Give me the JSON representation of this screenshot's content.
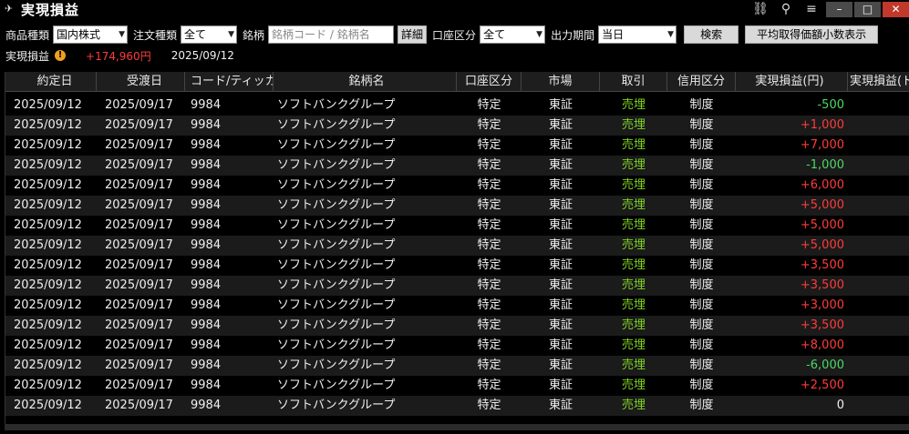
{
  "window": {
    "title": "実現損益",
    "icons": [
      "link-icon",
      "search-icon",
      "menu-icon"
    ],
    "minimize": "–",
    "maximize": "□",
    "close": "✕"
  },
  "filters": {
    "product_label": "商品種類",
    "product_value": "国内株式",
    "order_label": "注文種類",
    "order_value": "全て",
    "symbol_label": "銘柄",
    "symbol_placeholder": "銘柄コード / 銘柄名",
    "detail_button": "詳細",
    "account_label": "口座区分",
    "account_value": "全て",
    "period_label": "出力期間",
    "period_value": "当日",
    "search_button": "検索",
    "avg_button": "平均取得価額小数表示"
  },
  "summary": {
    "label": "実現損益",
    "value": "+174,960円",
    "date": "2025/09/12"
  },
  "table": {
    "headers": [
      "約定日",
      "受渡日",
      "コード/ティッカー",
      "銘柄名",
      "口座区分",
      "市場",
      "取引",
      "信用区分",
      "実現損益(円)",
      "実現損益(ド"
    ],
    "rows": [
      {
        "trade_date": "2025/09/12",
        "settle_date": "2025/09/17",
        "code": "9984",
        "name": "ソフトバンクグループ",
        "account": "特定",
        "market": "東証",
        "trade": "売埋",
        "margin": "制度",
        "pnl": "-500",
        "sign": "neg"
      },
      {
        "trade_date": "2025/09/12",
        "settle_date": "2025/09/17",
        "code": "9984",
        "name": "ソフトバンクグループ",
        "account": "特定",
        "market": "東証",
        "trade": "売埋",
        "margin": "制度",
        "pnl": "+1,000",
        "sign": "pos"
      },
      {
        "trade_date": "2025/09/12",
        "settle_date": "2025/09/17",
        "code": "9984",
        "name": "ソフトバンクグループ",
        "account": "特定",
        "market": "東証",
        "trade": "売埋",
        "margin": "制度",
        "pnl": "+7,000",
        "sign": "pos"
      },
      {
        "trade_date": "2025/09/12",
        "settle_date": "2025/09/17",
        "code": "9984",
        "name": "ソフトバンクグループ",
        "account": "特定",
        "market": "東証",
        "trade": "売埋",
        "margin": "制度",
        "pnl": "-1,000",
        "sign": "neg"
      },
      {
        "trade_date": "2025/09/12",
        "settle_date": "2025/09/17",
        "code": "9984",
        "name": "ソフトバンクグループ",
        "account": "特定",
        "market": "東証",
        "trade": "売埋",
        "margin": "制度",
        "pnl": "+6,000",
        "sign": "pos"
      },
      {
        "trade_date": "2025/09/12",
        "settle_date": "2025/09/17",
        "code": "9984",
        "name": "ソフトバンクグループ",
        "account": "特定",
        "market": "東証",
        "trade": "売埋",
        "margin": "制度",
        "pnl": "+5,000",
        "sign": "pos"
      },
      {
        "trade_date": "2025/09/12",
        "settle_date": "2025/09/17",
        "code": "9984",
        "name": "ソフトバンクグループ",
        "account": "特定",
        "market": "東証",
        "trade": "売埋",
        "margin": "制度",
        "pnl": "+5,000",
        "sign": "pos"
      },
      {
        "trade_date": "2025/09/12",
        "settle_date": "2025/09/17",
        "code": "9984",
        "name": "ソフトバンクグループ",
        "account": "特定",
        "market": "東証",
        "trade": "売埋",
        "margin": "制度",
        "pnl": "+5,000",
        "sign": "pos"
      },
      {
        "trade_date": "2025/09/12",
        "settle_date": "2025/09/17",
        "code": "9984",
        "name": "ソフトバンクグループ",
        "account": "特定",
        "market": "東証",
        "trade": "売埋",
        "margin": "制度",
        "pnl": "+3,500",
        "sign": "pos"
      },
      {
        "trade_date": "2025/09/12",
        "settle_date": "2025/09/17",
        "code": "9984",
        "name": "ソフトバンクグループ",
        "account": "特定",
        "market": "東証",
        "trade": "売埋",
        "margin": "制度",
        "pnl": "+3,500",
        "sign": "pos"
      },
      {
        "trade_date": "2025/09/12",
        "settle_date": "2025/09/17",
        "code": "9984",
        "name": "ソフトバンクグループ",
        "account": "特定",
        "market": "東証",
        "trade": "売埋",
        "margin": "制度",
        "pnl": "+3,000",
        "sign": "pos"
      },
      {
        "trade_date": "2025/09/12",
        "settle_date": "2025/09/17",
        "code": "9984",
        "name": "ソフトバンクグループ",
        "account": "特定",
        "market": "東証",
        "trade": "売埋",
        "margin": "制度",
        "pnl": "+3,500",
        "sign": "pos"
      },
      {
        "trade_date": "2025/09/12",
        "settle_date": "2025/09/17",
        "code": "9984",
        "name": "ソフトバンクグループ",
        "account": "特定",
        "market": "東証",
        "trade": "売埋",
        "margin": "制度",
        "pnl": "+8,000",
        "sign": "pos"
      },
      {
        "trade_date": "2025/09/12",
        "settle_date": "2025/09/17",
        "code": "9984",
        "name": "ソフトバンクグループ",
        "account": "特定",
        "market": "東証",
        "trade": "売埋",
        "margin": "制度",
        "pnl": "-6,000",
        "sign": "neg"
      },
      {
        "trade_date": "2025/09/12",
        "settle_date": "2025/09/17",
        "code": "9984",
        "name": "ソフトバンクグループ",
        "account": "特定",
        "market": "東証",
        "trade": "売埋",
        "margin": "制度",
        "pnl": "+2,500",
        "sign": "pos"
      },
      {
        "trade_date": "2025/09/12",
        "settle_date": "2025/09/17",
        "code": "9984",
        "name": "ソフトバンクグループ",
        "account": "特定",
        "market": "東証",
        "trade": "売埋",
        "margin": "制度",
        "pnl": "0",
        "sign": "zero"
      }
    ]
  }
}
